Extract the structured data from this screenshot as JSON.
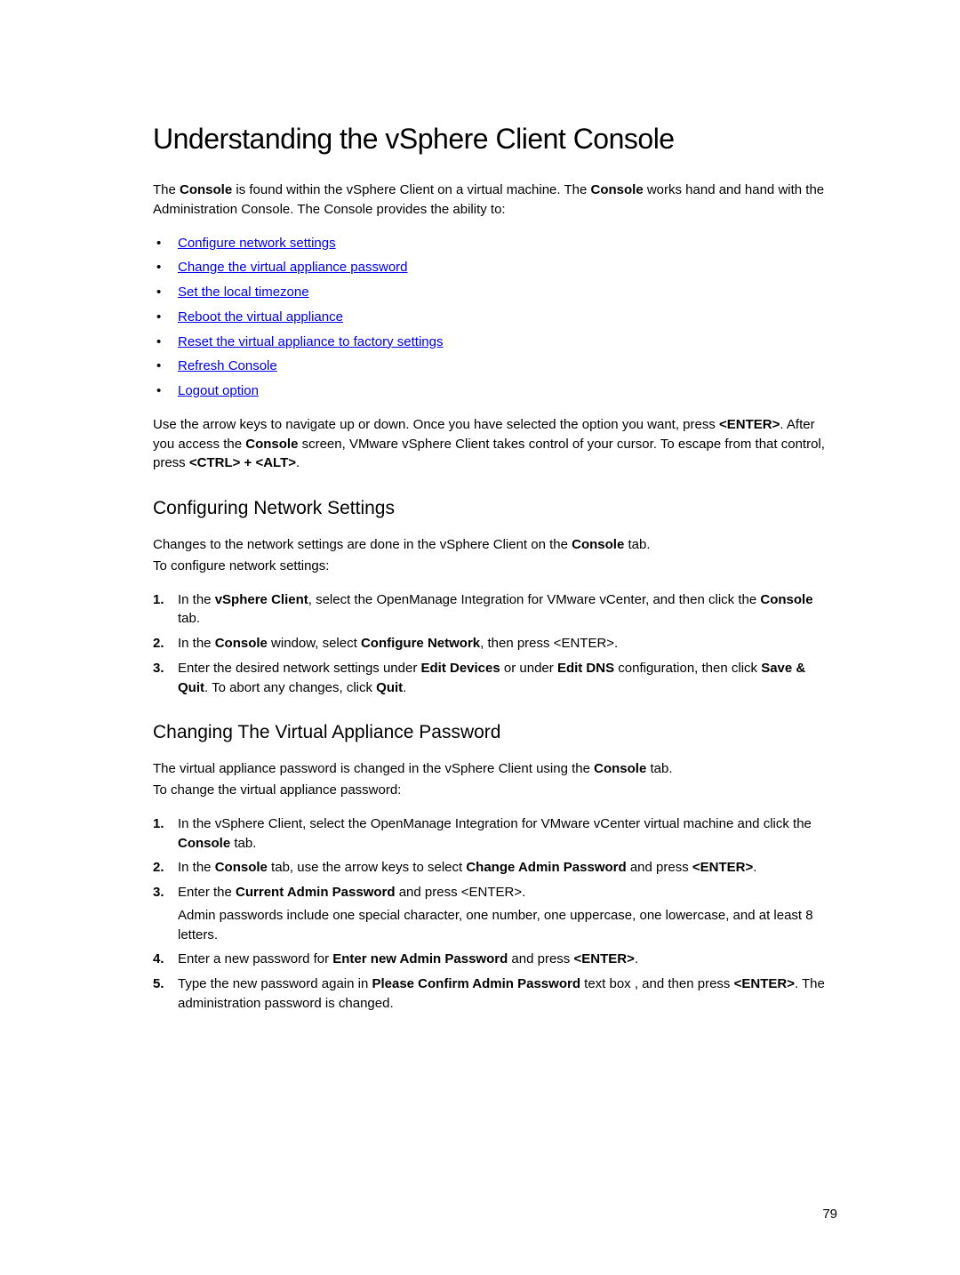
{
  "title": "Understanding the vSphere Client Console",
  "intro": {
    "p1a": "The ",
    "p1b": "Console",
    "p1c": " is found within the vSphere Client on a virtual machine. The ",
    "p1d": "Console",
    "p1e": " works hand and hand with the Administration Console. The Console provides the ability to:"
  },
  "links": [
    "Configure network settings",
    "Change the virtual appliance password",
    "Set the local timezone",
    "Reboot the virtual appliance",
    "Reset the virtual appliance to factory settings",
    "Refresh Console",
    "Logout option"
  ],
  "navpara": {
    "a": "Use the arrow keys to navigate up or down. Once you have selected the option you want, press ",
    "b": "<ENTER>",
    "c": ". After you access the ",
    "d": "Console",
    "e": " screen, VMware vSphere Client takes control of your cursor. To escape from that control, press ",
    "f": "<CTRL> + <ALT>",
    "g": "."
  },
  "sec1": {
    "heading": "Configuring Network Settings",
    "p1a": "Changes to the network settings are done in the vSphere Client on the ",
    "p1b": "Console",
    "p1c": " tab.",
    "p2": "To configure network settings:",
    "steps": {
      "s1a": "In the ",
      "s1b": "vSphere Client",
      "s1c": ", select the OpenManage Integration for VMware vCenter, and then click the ",
      "s1d": "Console",
      "s1e": " tab.",
      "s2a": "In the ",
      "s2b": "Console",
      "s2c": " window, select ",
      "s2d": "Configure Network",
      "s2e": ", then press <ENTER>.",
      "s3a": "Enter the desired network settings under ",
      "s3b": "Edit Devices",
      "s3c": " or under ",
      "s3d": "Edit DNS",
      "s3e": " configuration, then click ",
      "s3f": "Save & Quit",
      "s3g": ". To abort any changes, click ",
      "s3h": "Quit",
      "s3i": "."
    }
  },
  "sec2": {
    "heading": "Changing The Virtual Appliance Password",
    "p1a": "The virtual appliance password is changed in the vSphere Client using the ",
    "p1b": "Console",
    "p1c": " tab.",
    "p2": "To change the virtual appliance password:",
    "steps": {
      "s1a": "In the vSphere Client, select the OpenManage Integration for VMware vCenter virtual machine and click the ",
      "s1b": "Console",
      "s1c": " tab.",
      "s2a": "In the ",
      "s2b": "Console",
      "s2c": " tab, use the arrow keys to select ",
      "s2d": "Change Admin Password",
      "s2e": " and press ",
      "s2f": "<ENTER>",
      "s2g": ".",
      "s3a": "Enter the ",
      "s3b": "Current Admin Password",
      "s3c": " and press <ENTER>.",
      "s3d": "Admin passwords include one special character, one number, one uppercase, one lowercase, and at least 8 letters.",
      "s4a": "Enter a new password for ",
      "s4b": "Enter new Admin Password",
      "s4c": " and press ",
      "s4d": "<ENTER>",
      "s4e": ".",
      "s5a": "Type the new password again in ",
      "s5b": "Please Confirm Admin Password",
      "s5c": " text box , and then press ",
      "s5d": "<ENTER>",
      "s5e": ". The administration password is changed."
    }
  },
  "pageNumber": "79"
}
